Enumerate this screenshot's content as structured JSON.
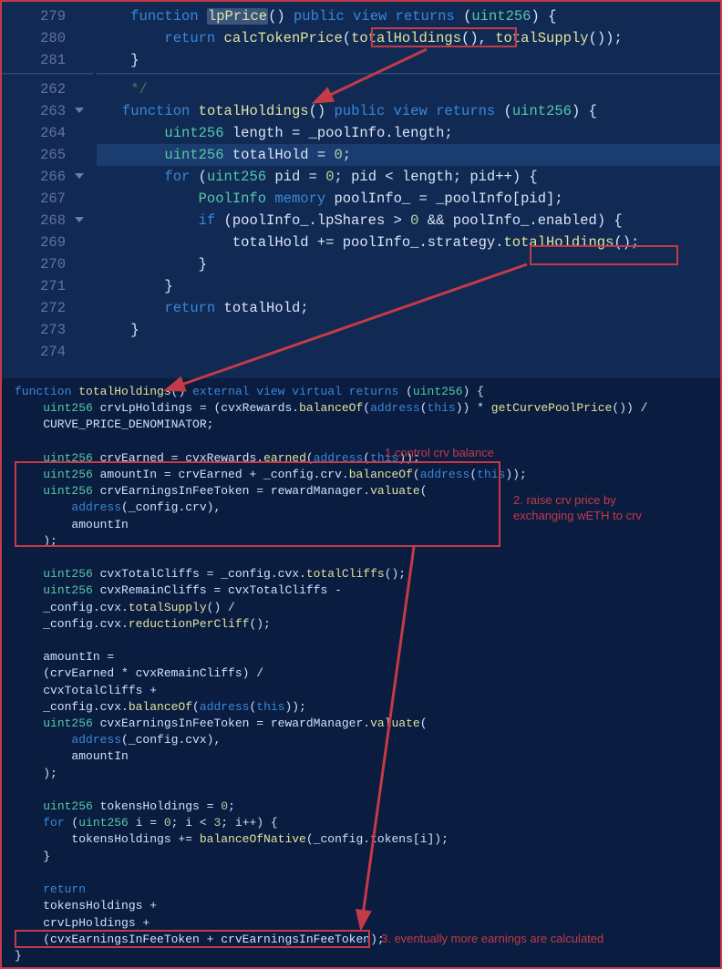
{
  "panel1": {
    "lines_top": [
      {
        "no": "279",
        "fold": false
      },
      {
        "no": "280",
        "fold": false
      },
      {
        "no": "281",
        "fold": false
      }
    ],
    "lines_bottom": [
      {
        "no": "262",
        "fold": false
      },
      {
        "no": "263",
        "fold": true
      },
      {
        "no": "264",
        "fold": false
      },
      {
        "no": "265",
        "fold": false
      },
      {
        "no": "266",
        "fold": true
      },
      {
        "no": "267",
        "fold": false
      },
      {
        "no": "268",
        "fold": true
      },
      {
        "no": "269",
        "fold": false
      },
      {
        "no": "270",
        "fold": false
      },
      {
        "no": "271",
        "fold": false
      },
      {
        "no": "272",
        "fold": false
      },
      {
        "no": "273",
        "fold": false
      },
      {
        "no": "274",
        "fold": false
      }
    ],
    "code_279_pre": "    ",
    "code_279_function": "function",
    "code_279_fn": "lpPrice",
    "code_279_rest1": "() ",
    "code_279_public": "public",
    "code_279_sp": " ",
    "code_279_view": "view",
    "code_279_sp2": " ",
    "code_279_returns": "returns",
    "code_279_rest2": " (",
    "code_279_uint": "uint256",
    "code_279_rest3": ") {",
    "code_280_pre": "        ",
    "code_280_return": "return",
    "code_280_sp": " ",
    "code_280_calc": "calcTokenPrice",
    "code_280_op1": "(",
    "code_280_th": "totalHoldings",
    "code_280_op2": "(), ",
    "code_280_ts": "totalSupply",
    "code_280_op3": "());",
    "code_281": "    }",
    "code_262": "    */",
    "code_263_pre": "   ",
    "code_263_function": "function",
    "code_263_sp": " ",
    "code_263_fn": "totalHoldings",
    "code_263_rest1": "() ",
    "code_263_public": "public",
    "code_263_sp2": " ",
    "code_263_view": "view",
    "code_263_sp3": " ",
    "code_263_returns": "returns",
    "code_263_rest2": " (",
    "code_263_uint": "uint256",
    "code_263_rest3": ") {",
    "code_264_pre": "        ",
    "code_264_uint": "uint256",
    "code_264_rest": " length = _poolInfo.length;",
    "code_265_pre": "        ",
    "code_265_uint": "uint256",
    "code_265_rest": " totalHold = ",
    "code_265_zero": "0",
    "code_265_semi": ";",
    "code_266_pre": "        ",
    "code_266_for": "for",
    "code_266_op1": " (",
    "code_266_uint": "uint256",
    "code_266_rest1": " pid = ",
    "code_266_zero": "0",
    "code_266_rest2": "; pid < length; pid++) {",
    "code_267_pre": "            ",
    "code_267_ty": "PoolInfo",
    "code_267_sp": " ",
    "code_267_mem": "memory",
    "code_267_rest": " poolInfo_ = _poolInfo[pid];",
    "code_268_pre": "            ",
    "code_268_if": "if",
    "code_268_rest1": " (poolInfo_.lpShares > ",
    "code_268_zero": "0",
    "code_268_rest2": " && poolInfo_.enabled) {",
    "code_269_pre": "                totalHold += poolInfo_.strategy.",
    "code_269_fn": "totalHoldings",
    "code_269_rest": "();",
    "code_270": "            }",
    "code_271": "        }",
    "code_272_pre": "        ",
    "code_272_return": "return",
    "code_272_rest": " totalHold;",
    "code_273": "    }",
    "code_274": ""
  },
  "panel2": {
    "l1a": "function",
    "l1b": " ",
    "l1c": "totalHoldings",
    "l1d": "() ",
    "l1e": "external view virtual returns",
    "l1f": " (",
    "l1g": "uint256",
    "l1h": ") {",
    "l2a": "    ",
    "l2b": "uint256",
    "l2c": " crvLpHoldings = (cvxRewards.",
    "l2d": "balanceOf",
    "l2e": "(",
    "l2f": "address",
    "l2g": "(",
    "l2h": "this",
    "l2i": ")) * ",
    "l2j": "getCurvePoolPrice",
    "l2k": "()) /",
    "l3": "    CURVE_PRICE_DENOMINATOR;",
    "l4": "",
    "l5a": "    ",
    "l5b": "uint256",
    "l5c": " crvEarned = cvxRewards.",
    "l5d": "earned",
    "l5e": "(",
    "l5f": "address",
    "l5g": "(",
    "l5h": "this",
    "l5i": "));",
    "l6a": "    ",
    "l6b": "uint256",
    "l6c": " amountIn = crvEarned + _config.crv.",
    "l6d": "balanceOf",
    "l6e": "(",
    "l6f": "address",
    "l6g": "(",
    "l6h": "this",
    "l6i": "));",
    "l7a": "    ",
    "l7b": "uint256",
    "l7c": " crvEarningsInFeeToken = rewardManager.",
    "l7d": "valuate",
    "l7e": "(",
    "l8a": "        ",
    "l8b": "address",
    "l8c": "(_config.crv),",
    "l9": "        amountIn",
    "l10": "    );",
    "l11": "",
    "l12a": "    ",
    "l12b": "uint256",
    "l12c": " cvxTotalCliffs = _config.cvx.",
    "l12d": "totalCliffs",
    "l12e": "();",
    "l13a": "    ",
    "l13b": "uint256",
    "l13c": " cvxRemainCliffs = cvxTotalCliffs -",
    "l14": "    _config.cvx.",
    "l14b": "totalSupply",
    "l14c": "() /",
    "l15": "    _config.cvx.",
    "l15b": "reductionPerCliff",
    "l15c": "();",
    "l16": "",
    "l17": "    amountIn =",
    "l18": "    (crvEarned * cvxRemainCliffs) /",
    "l19": "    cvxTotalCliffs +",
    "l20": "    _config.cvx.",
    "l20b": "balanceOf",
    "l20c": "(",
    "l20d": "address",
    "l20e": "(",
    "l20f": "this",
    "l20g": "));",
    "l21a": "    ",
    "l21b": "uint256",
    "l21c": " cvxEarningsInFeeToken = rewardManager.",
    "l21d": "valuate",
    "l21e": "(",
    "l22a": "        ",
    "l22b": "address",
    "l22c": "(_config.cvx),",
    "l23": "        amountIn",
    "l24": "    );",
    "l25": "",
    "l26a": "    ",
    "l26b": "uint256",
    "l26c": " tokensHoldings = ",
    "l26d": "0",
    "l26e": ";",
    "l27a": "    ",
    "l27b": "for",
    "l27c": " (",
    "l27d": "uint256",
    "l27e": " i = ",
    "l27f": "0",
    "l27g": "; i < ",
    "l27h": "3",
    "l27i": "; i++) {",
    "l28": "        tokensHoldings += ",
    "l28b": "balanceOfNative",
    "l28c": "(_config.tokens[i]);",
    "l29": "    }",
    "l30": "",
    "l31": "    ",
    "l31b": "return",
    "l32": "    tokensHoldings +",
    "l33": "    crvLpHoldings +",
    "l34": "    (cvxEarningsInFeeToken + crvEarningsInFeeToken);",
    "l35": "}"
  },
  "annotations": {
    "a1": "1.control crv balance",
    "a2a": "2. raise crv price by",
    "a2b": "exchanging wETH to crv",
    "a3": "3. eventually more earnings are calculated"
  }
}
